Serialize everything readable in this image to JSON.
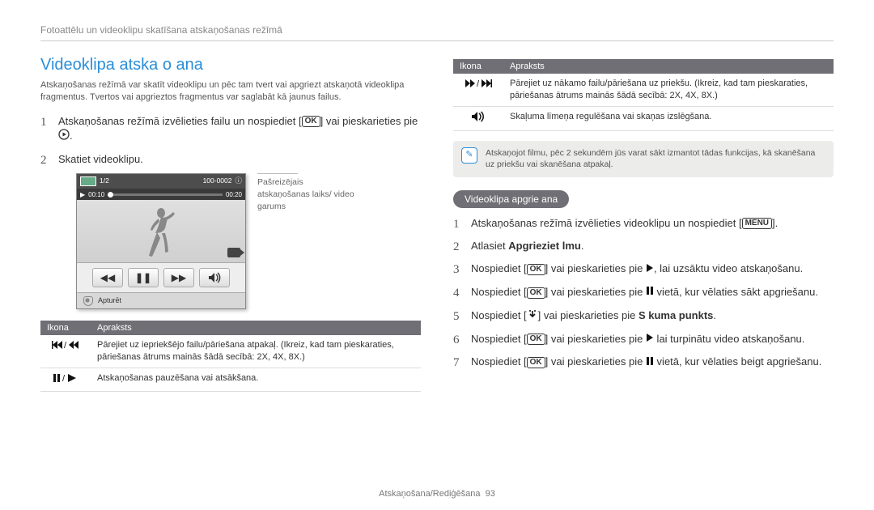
{
  "header": {
    "breadcrumb": "Fotoattēlu un videoklipu skatīšana atskaņošanas režīmā"
  },
  "left": {
    "title": "Videoklipa atska o ana",
    "intro": "Atskaņošanas režīmā var skatīt videoklipu un pēc tam tvert vai apgriezt atskaņotā videoklipa fragmentus. Tvertos vai apgrieztos fragmentus var saglabāt kā jaunus failus.",
    "step1_a": "Atskaņošanas režīmā izvēlieties failu un nospiediet [",
    "step1_b": "] vai pieskarieties pie ",
    "step1_c": ".",
    "step2": "Skatiet videoklipu.",
    "ok_label": "OK",
    "player": {
      "count": "1/2",
      "clip_id": "100-0002",
      "time_cur": "00:10",
      "time_total": "00:20",
      "stop": "Apturēt"
    },
    "caption": "Pašreizējais atskaņošanas laiks/ video garums",
    "table_h1": "Ikona",
    "table_h2": "Apraksts",
    "row1": "Pārejiet uz iepriekšējo failu/pāriešana atpakaļ. (Ikreiz, kad tam pieskaraties, pāriešanas ātrums mainās šādā secībā: 2X, 4X, 8X.)",
    "row2": "Atskaņošanas pauzēšana vai atsākšana."
  },
  "right": {
    "table_h1": "Ikona",
    "table_h2": "Apraksts",
    "r1": "Pārejiet uz nākamo failu/pāriešana uz priekšu. (Ikreiz, kad tam pieskaraties, pāriešanas ātrums mainās šādā secībā: 2X, 4X, 8X.)",
    "r2": "Skaļuma līmeņa regulēšana vai skaņas izslēgšana.",
    "note": "Atskaņojot filmu, pēc 2 sekundēm jūs varat sākt izmantot tādas funkcijas, kā skanēšana uz priekšu vai skanēšana atpakaļ.",
    "sub_heading": "Videoklipa apgrie ana",
    "s1_a": "Atskaņošanas režīmā izvēlieties videoklipu un nospiediet [",
    "s1_b": "].",
    "menu_label": "MENU",
    "s2_a": "Atlasiet ",
    "s2_b": "Apgrieziet  lmu",
    "s2_c": ".",
    "s3_a": "Nospiediet [",
    "s3_b": "] vai pieskarieties pie ",
    "s3_c": ", lai uzsāktu video atskaņošanu.",
    "s4_a": "Nospiediet [",
    "s4_b": "] vai pieskarieties pie ",
    "s4_c": " vietā, kur vēlaties sākt apgriešanu.",
    "s5_a": "Nospiediet [",
    "s5_b": "] vai pieskarieties pie ",
    "s5_c": "S kuma punkts",
    "s5_d": ".",
    "s6_a": "Nospiediet [",
    "s6_b": "] vai pieskarieties pie ",
    "s6_c": " lai turpinātu video atskaņošanu.",
    "s7_a": "Nospiediet [",
    "s7_b": "] vai pieskarieties pie ",
    "s7_c": " vietā, kur vēlaties beigt apgriešanu.",
    "ok_label": "OK"
  },
  "footer": {
    "section": "Atskaņošana/Rediģēšana",
    "page": "93"
  }
}
